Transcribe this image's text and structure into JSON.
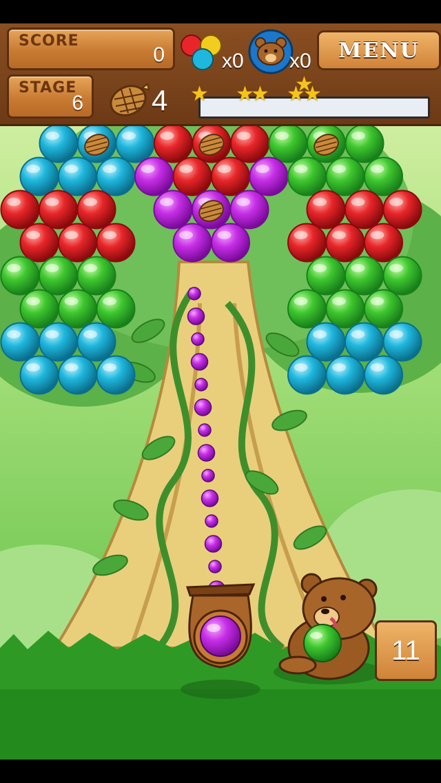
{
  "hud": {
    "score_label": "SCORE",
    "score_value": "0",
    "stage_label": "STAGE",
    "stage_value": "6",
    "pinecone_count": "4",
    "bubbles_count": "x0",
    "bear_count": "x0",
    "menu_label": "MENU",
    "progress_fraction": 0.0
  },
  "shots_left": "11",
  "colors": {
    "cyan": "#1fb7dd",
    "red": "#e8262a",
    "green": "#39c22d",
    "purple": "#b21ed6",
    "hud_wood": "#c97b33"
  },
  "grid": [
    [
      "cyan",
      "cyan*",
      "cyan",
      "red",
      "red*",
      "red",
      "green",
      "green*",
      "green"
    ],
    [
      "cyan",
      "cyan",
      "cyan",
      "purple",
      "red",
      "red",
      "purple",
      "green",
      "green",
      "green"
    ],
    [
      "red",
      "red",
      "red",
      "",
      "purple",
      "purple*",
      "purple",
      "",
      "red",
      "red",
      "red"
    ],
    [
      "red",
      "red",
      "red",
      "",
      "purple",
      "purple",
      "",
      "red",
      "red",
      "red"
    ],
    [
      "green",
      "green",
      "green",
      "",
      "",
      "",
      "",
      "",
      "green",
      "green",
      "green"
    ],
    [
      "green",
      "green",
      "green",
      "",
      "",
      "",
      "",
      "green",
      "green",
      "green"
    ],
    [
      "cyan",
      "cyan",
      "cyan",
      "",
      "",
      "",
      "",
      "",
      "cyan",
      "cyan",
      "cyan"
    ],
    [
      "cyan",
      "cyan",
      "cyan",
      "",
      "",
      "",
      "",
      "cyan",
      "cyan",
      "cyan"
    ]
  ],
  "loaded_bubble": "purple",
  "next_bubble": "green"
}
